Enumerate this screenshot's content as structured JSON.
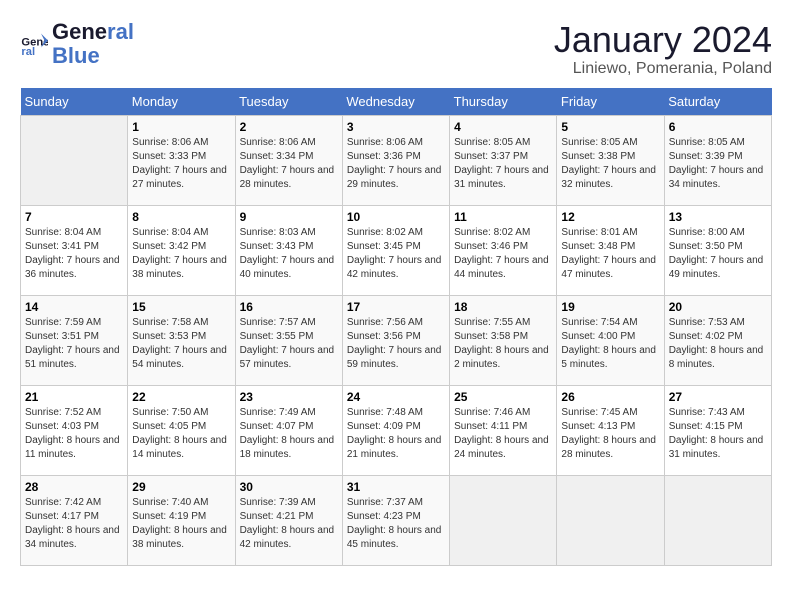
{
  "header": {
    "logo_general": "General",
    "logo_blue": "Blue",
    "month_title": "January 2024",
    "location": "Liniewo, Pomerania, Poland"
  },
  "weekdays": [
    "Sunday",
    "Monday",
    "Tuesday",
    "Wednesday",
    "Thursday",
    "Friday",
    "Saturday"
  ],
  "weeks": [
    [
      {
        "day": "",
        "sunrise": "",
        "sunset": "",
        "daylight": ""
      },
      {
        "day": "1",
        "sunrise": "Sunrise: 8:06 AM",
        "sunset": "Sunset: 3:33 PM",
        "daylight": "Daylight: 7 hours and 27 minutes."
      },
      {
        "day": "2",
        "sunrise": "Sunrise: 8:06 AM",
        "sunset": "Sunset: 3:34 PM",
        "daylight": "Daylight: 7 hours and 28 minutes."
      },
      {
        "day": "3",
        "sunrise": "Sunrise: 8:06 AM",
        "sunset": "Sunset: 3:36 PM",
        "daylight": "Daylight: 7 hours and 29 minutes."
      },
      {
        "day": "4",
        "sunrise": "Sunrise: 8:05 AM",
        "sunset": "Sunset: 3:37 PM",
        "daylight": "Daylight: 7 hours and 31 minutes."
      },
      {
        "day": "5",
        "sunrise": "Sunrise: 8:05 AM",
        "sunset": "Sunset: 3:38 PM",
        "daylight": "Daylight: 7 hours and 32 minutes."
      },
      {
        "day": "6",
        "sunrise": "Sunrise: 8:05 AM",
        "sunset": "Sunset: 3:39 PM",
        "daylight": "Daylight: 7 hours and 34 minutes."
      }
    ],
    [
      {
        "day": "7",
        "sunrise": "Sunrise: 8:04 AM",
        "sunset": "Sunset: 3:41 PM",
        "daylight": "Daylight: 7 hours and 36 minutes."
      },
      {
        "day": "8",
        "sunrise": "Sunrise: 8:04 AM",
        "sunset": "Sunset: 3:42 PM",
        "daylight": "Daylight: 7 hours and 38 minutes."
      },
      {
        "day": "9",
        "sunrise": "Sunrise: 8:03 AM",
        "sunset": "Sunset: 3:43 PM",
        "daylight": "Daylight: 7 hours and 40 minutes."
      },
      {
        "day": "10",
        "sunrise": "Sunrise: 8:02 AM",
        "sunset": "Sunset: 3:45 PM",
        "daylight": "Daylight: 7 hours and 42 minutes."
      },
      {
        "day": "11",
        "sunrise": "Sunrise: 8:02 AM",
        "sunset": "Sunset: 3:46 PM",
        "daylight": "Daylight: 7 hours and 44 minutes."
      },
      {
        "day": "12",
        "sunrise": "Sunrise: 8:01 AM",
        "sunset": "Sunset: 3:48 PM",
        "daylight": "Daylight: 7 hours and 47 minutes."
      },
      {
        "day": "13",
        "sunrise": "Sunrise: 8:00 AM",
        "sunset": "Sunset: 3:50 PM",
        "daylight": "Daylight: 7 hours and 49 minutes."
      }
    ],
    [
      {
        "day": "14",
        "sunrise": "Sunrise: 7:59 AM",
        "sunset": "Sunset: 3:51 PM",
        "daylight": "Daylight: 7 hours and 51 minutes."
      },
      {
        "day": "15",
        "sunrise": "Sunrise: 7:58 AM",
        "sunset": "Sunset: 3:53 PM",
        "daylight": "Daylight: 7 hours and 54 minutes."
      },
      {
        "day": "16",
        "sunrise": "Sunrise: 7:57 AM",
        "sunset": "Sunset: 3:55 PM",
        "daylight": "Daylight: 7 hours and 57 minutes."
      },
      {
        "day": "17",
        "sunrise": "Sunrise: 7:56 AM",
        "sunset": "Sunset: 3:56 PM",
        "daylight": "Daylight: 7 hours and 59 minutes."
      },
      {
        "day": "18",
        "sunrise": "Sunrise: 7:55 AM",
        "sunset": "Sunset: 3:58 PM",
        "daylight": "Daylight: 8 hours and 2 minutes."
      },
      {
        "day": "19",
        "sunrise": "Sunrise: 7:54 AM",
        "sunset": "Sunset: 4:00 PM",
        "daylight": "Daylight: 8 hours and 5 minutes."
      },
      {
        "day": "20",
        "sunrise": "Sunrise: 7:53 AM",
        "sunset": "Sunset: 4:02 PM",
        "daylight": "Daylight: 8 hours and 8 minutes."
      }
    ],
    [
      {
        "day": "21",
        "sunrise": "Sunrise: 7:52 AM",
        "sunset": "Sunset: 4:03 PM",
        "daylight": "Daylight: 8 hours and 11 minutes."
      },
      {
        "day": "22",
        "sunrise": "Sunrise: 7:50 AM",
        "sunset": "Sunset: 4:05 PM",
        "daylight": "Daylight: 8 hours and 14 minutes."
      },
      {
        "day": "23",
        "sunrise": "Sunrise: 7:49 AM",
        "sunset": "Sunset: 4:07 PM",
        "daylight": "Daylight: 8 hours and 18 minutes."
      },
      {
        "day": "24",
        "sunrise": "Sunrise: 7:48 AM",
        "sunset": "Sunset: 4:09 PM",
        "daylight": "Daylight: 8 hours and 21 minutes."
      },
      {
        "day": "25",
        "sunrise": "Sunrise: 7:46 AM",
        "sunset": "Sunset: 4:11 PM",
        "daylight": "Daylight: 8 hours and 24 minutes."
      },
      {
        "day": "26",
        "sunrise": "Sunrise: 7:45 AM",
        "sunset": "Sunset: 4:13 PM",
        "daylight": "Daylight: 8 hours and 28 minutes."
      },
      {
        "day": "27",
        "sunrise": "Sunrise: 7:43 AM",
        "sunset": "Sunset: 4:15 PM",
        "daylight": "Daylight: 8 hours and 31 minutes."
      }
    ],
    [
      {
        "day": "28",
        "sunrise": "Sunrise: 7:42 AM",
        "sunset": "Sunset: 4:17 PM",
        "daylight": "Daylight: 8 hours and 34 minutes."
      },
      {
        "day": "29",
        "sunrise": "Sunrise: 7:40 AM",
        "sunset": "Sunset: 4:19 PM",
        "daylight": "Daylight: 8 hours and 38 minutes."
      },
      {
        "day": "30",
        "sunrise": "Sunrise: 7:39 AM",
        "sunset": "Sunset: 4:21 PM",
        "daylight": "Daylight: 8 hours and 42 minutes."
      },
      {
        "day": "31",
        "sunrise": "Sunrise: 7:37 AM",
        "sunset": "Sunset: 4:23 PM",
        "daylight": "Daylight: 8 hours and 45 minutes."
      },
      {
        "day": "",
        "sunrise": "",
        "sunset": "",
        "daylight": ""
      },
      {
        "day": "",
        "sunrise": "",
        "sunset": "",
        "daylight": ""
      },
      {
        "day": "",
        "sunrise": "",
        "sunset": "",
        "daylight": ""
      }
    ]
  ]
}
